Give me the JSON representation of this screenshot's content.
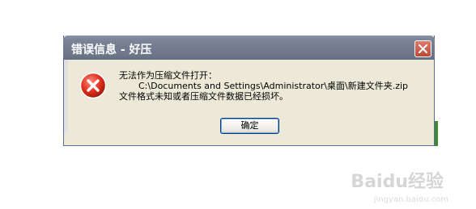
{
  "dialog": {
    "title": "错误信息 - 好压",
    "message_line1": "无法作为压缩文件打开：",
    "message_path": "C:\\Documents and Settings\\Administrator\\桌面\\新建文件夹.zip",
    "message_line3": "文件格式未知或者压缩文件数据已经损坏。",
    "ok_label": "确定",
    "icon": "error-icon"
  },
  "watermark": {
    "brand": "Baidu经验",
    "url": "jingyan.baidu.com"
  }
}
